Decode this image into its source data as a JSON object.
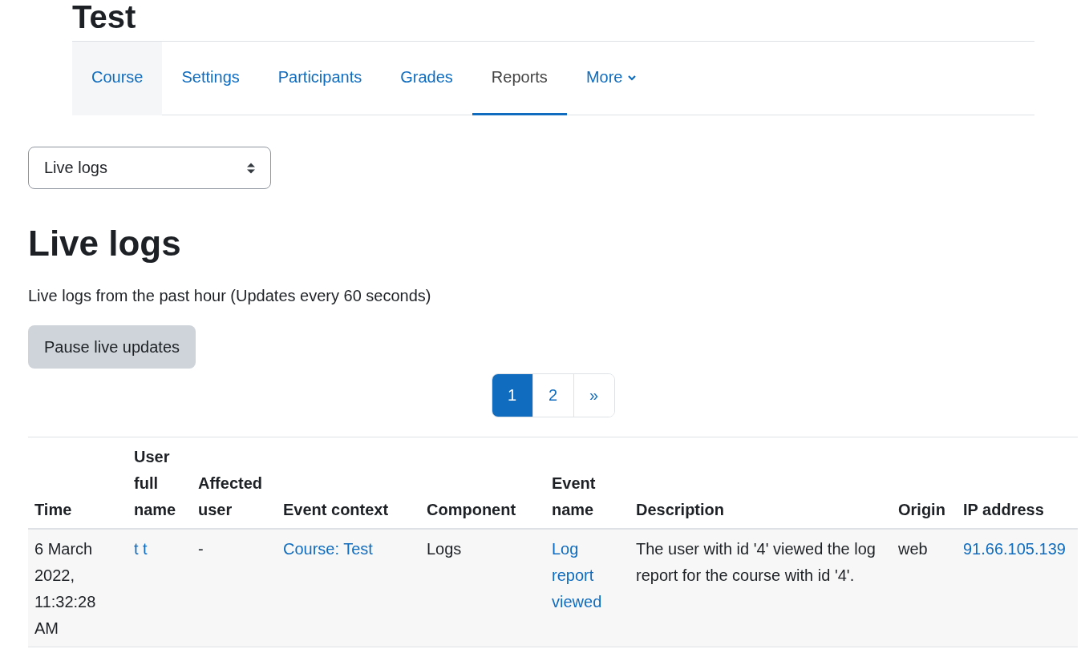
{
  "page_title": "Test",
  "nav_tabs": [
    {
      "label": "Course",
      "selected": false,
      "hovered": true,
      "kind": "tab"
    },
    {
      "label": "Settings",
      "selected": false,
      "hovered": false,
      "kind": "tab"
    },
    {
      "label": "Participants",
      "selected": false,
      "hovered": false,
      "kind": "tab"
    },
    {
      "label": "Grades",
      "selected": false,
      "hovered": false,
      "kind": "tab"
    },
    {
      "label": "Reports",
      "selected": true,
      "hovered": false,
      "kind": "tab"
    },
    {
      "label": "More",
      "selected": false,
      "hovered": false,
      "kind": "menu"
    }
  ],
  "report_select": {
    "value": "Live logs"
  },
  "heading": "Live logs",
  "description": "Live logs from the past hour (Updates every 60 seconds)",
  "pause_button": "Pause live updates",
  "pagination": [
    {
      "label": "1",
      "selected": true
    },
    {
      "label": "2",
      "selected": false
    },
    {
      "label": "»",
      "selected": false
    }
  ],
  "table": {
    "columns": [
      "Time",
      "User full name",
      "Affected user",
      "Event context",
      "Component",
      "Event name",
      "Description",
      "Origin",
      "IP address"
    ],
    "rows": [
      {
        "cells": [
          {
            "text": "6 March 2022, 11:32:28 AM",
            "link": false
          },
          {
            "text": "t t",
            "link": true
          },
          {
            "text": "-",
            "link": false
          },
          {
            "text": "Course: Test",
            "link": true
          },
          {
            "text": "Logs",
            "link": false
          },
          {
            "text": "Log report viewed",
            "link": true
          },
          {
            "text": "The user with id '4' viewed the log report for the course with id '4'.",
            "link": false
          },
          {
            "text": "web",
            "link": false
          },
          {
            "text": "91.66.105.139",
            "link": true
          }
        ]
      }
    ]
  }
}
